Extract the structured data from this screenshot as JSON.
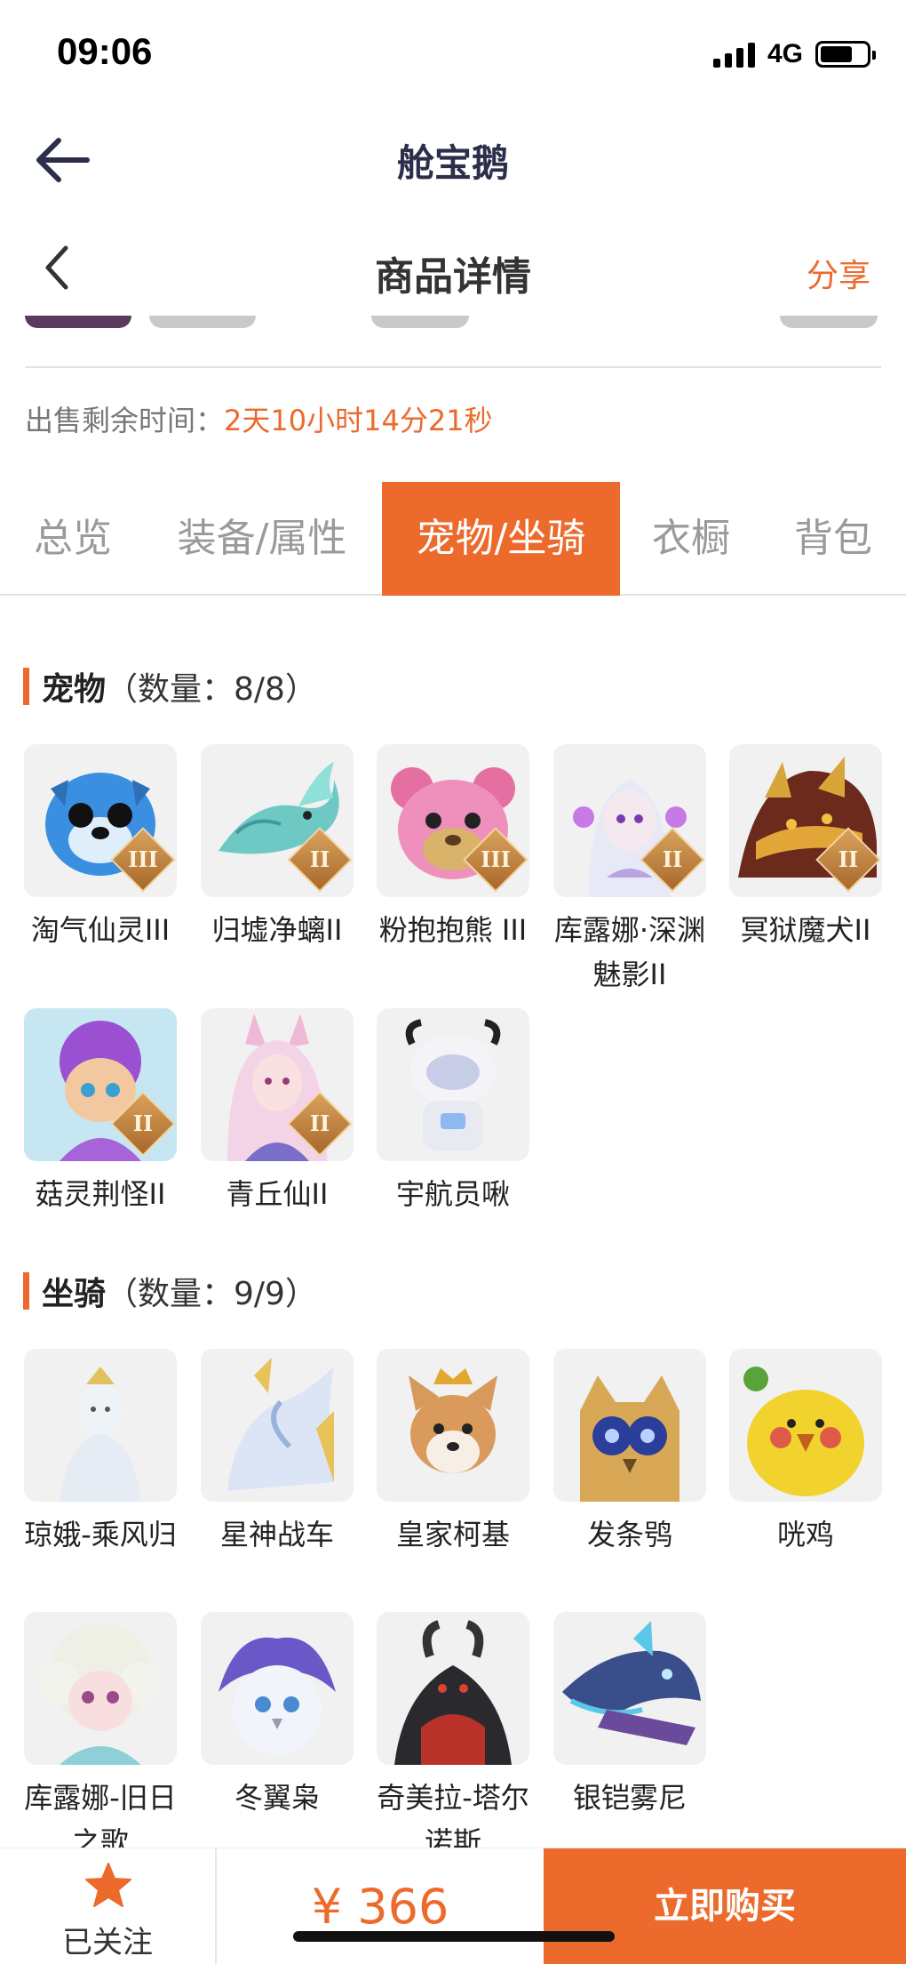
{
  "status": {
    "time": "09:06",
    "network": "4G"
  },
  "app_header": {
    "title": "舱宝鹅"
  },
  "page_header": {
    "title": "商品详情",
    "share": "分享"
  },
  "sale": {
    "label": "出售剩余时间：",
    "value": "2天10小时14分21秒"
  },
  "tabs": [
    {
      "label": "总览",
      "active": false
    },
    {
      "label": "装备/属性",
      "active": false
    },
    {
      "label": "宠物/坐骑",
      "active": true
    },
    {
      "label": "衣橱",
      "active": false
    },
    {
      "label": "背包",
      "active": false
    }
  ],
  "pets": {
    "name": "宠物",
    "count": "（数量：8/8）",
    "items": [
      {
        "label": "淘气仙灵III",
        "badge": "III"
      },
      {
        "label": "归墟净螭II",
        "badge": "II"
      },
      {
        "label": "粉抱抱熊 III",
        "badge": "III"
      },
      {
        "label": "库露娜·深渊魅影II",
        "badge": "II"
      },
      {
        "label": "冥狱魔犬II",
        "badge": "II"
      },
      {
        "label": "菇灵荆怪II",
        "badge": "II"
      },
      {
        "label": "青丘仙II",
        "badge": "II"
      },
      {
        "label": "宇航员啾",
        "badge": ""
      }
    ]
  },
  "mounts": {
    "name": "坐骑",
    "count": "（数量：9/9）",
    "items": [
      {
        "label": "琼娥-乘风归"
      },
      {
        "label": "星神战车"
      },
      {
        "label": "皇家柯基"
      },
      {
        "label": "发条鸮"
      },
      {
        "label": "咣鸡"
      },
      {
        "label": "库露娜-旧日之歌"
      },
      {
        "label": "冬翼枭"
      },
      {
        "label": "奇美拉-塔尔诺斯"
      },
      {
        "label": "银铠雾尼"
      }
    ]
  },
  "bottom": {
    "follow_label": "已关注",
    "price": "¥ 366",
    "buy_label": "立即购买"
  },
  "colors": {
    "accent": "#ec6a2c",
    "title": "#2b2f4a"
  }
}
